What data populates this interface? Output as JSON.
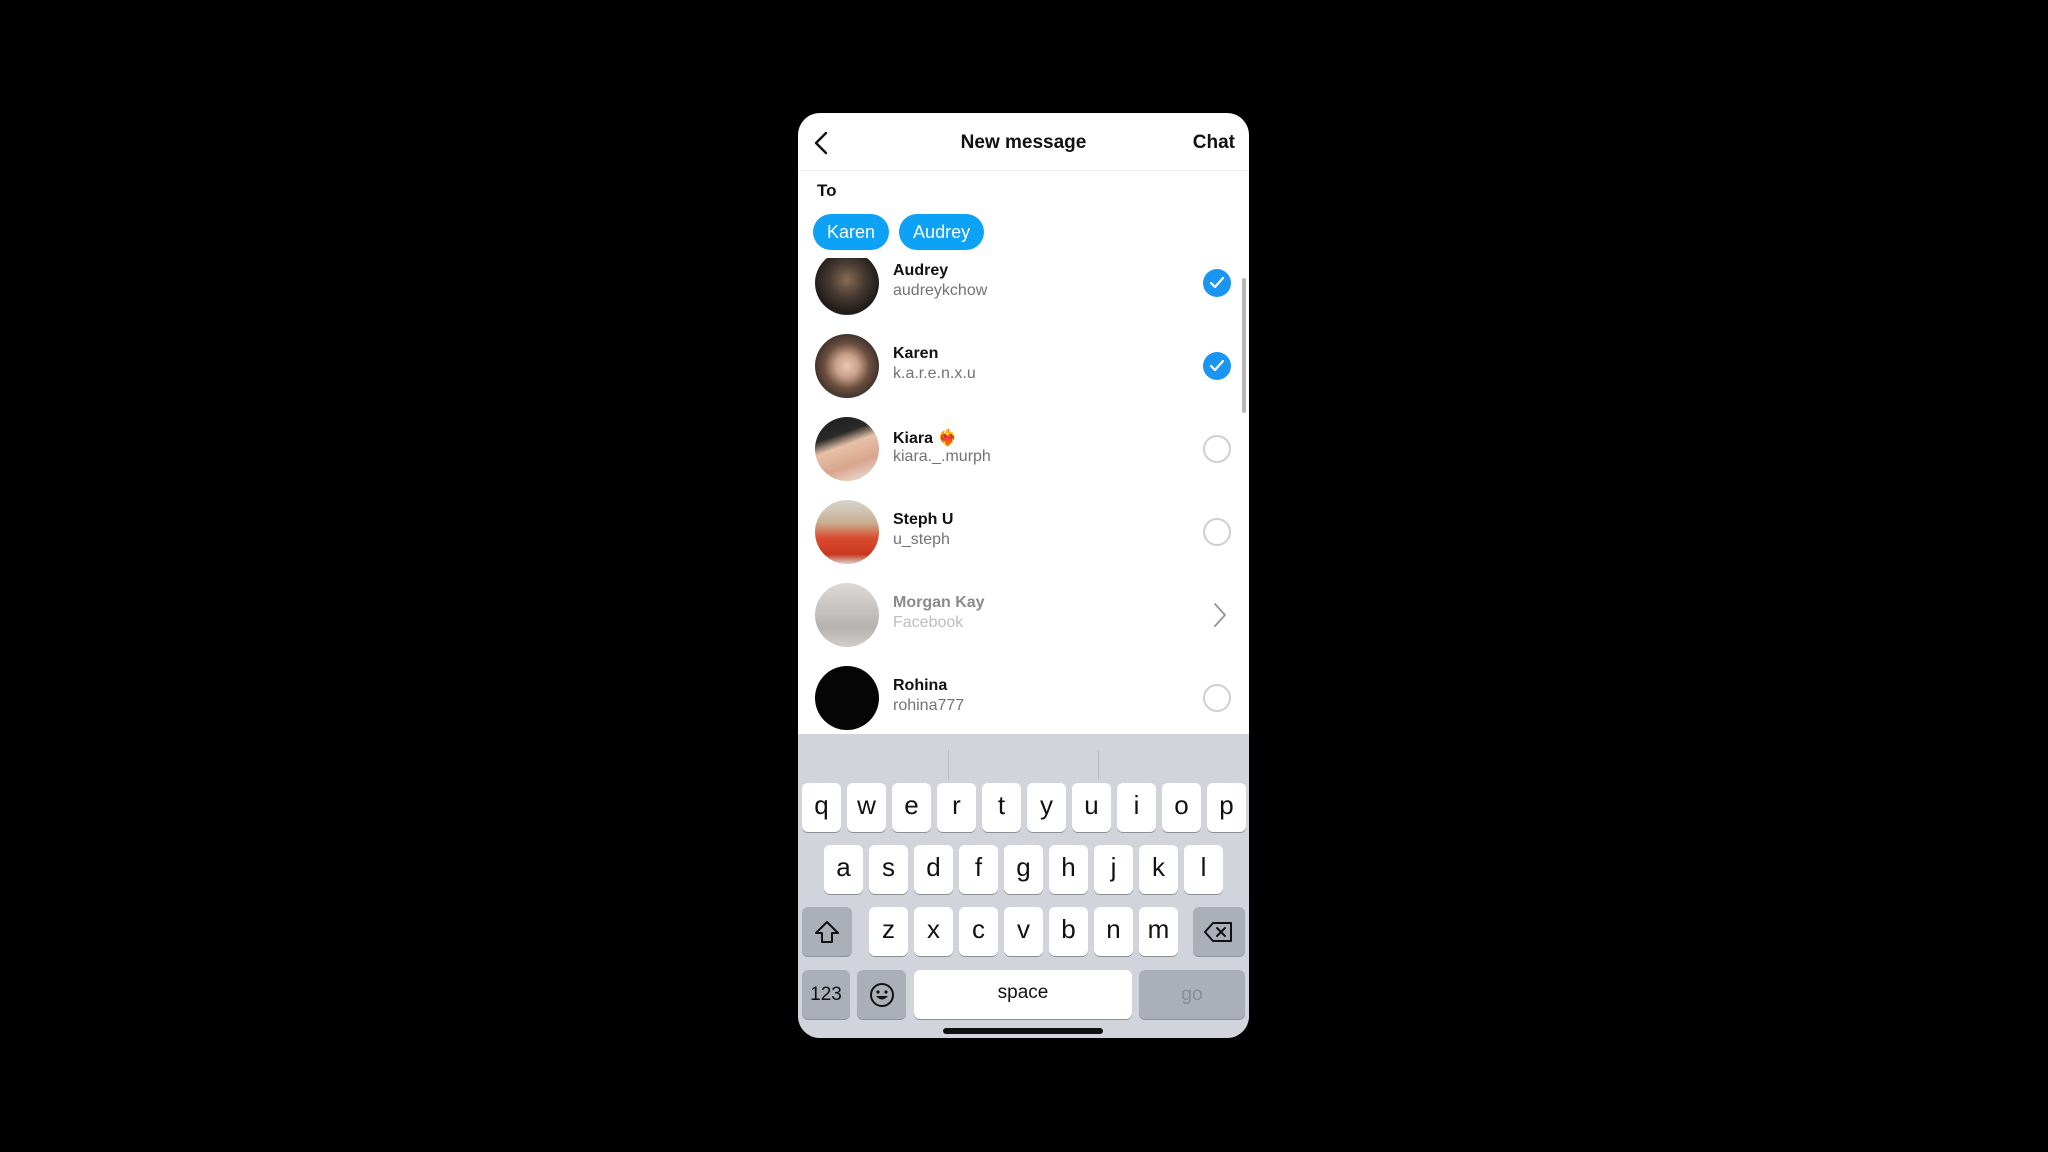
{
  "header": {
    "back_icon": "chevron-left-icon",
    "title": "New message",
    "chat_label": "Chat"
  },
  "recipients": {
    "to_label": "To",
    "chips": [
      "Karen",
      "Audrey"
    ],
    "chip_color": "#0da2f5"
  },
  "contacts": [
    {
      "name": "Audrey",
      "handle": "audreykchow",
      "state": "selected"
    },
    {
      "name": "Karen",
      "handle": "k.a.r.e.n.x.u",
      "state": "selected"
    },
    {
      "name": "Kiara ❤️‍🔥",
      "handle": "kiara._.murph",
      "state": "unselected"
    },
    {
      "name": "Steph U",
      "handle": "u_steph",
      "state": "unselected"
    },
    {
      "name": "Morgan Kay",
      "handle": "Facebook",
      "state": "external"
    },
    {
      "name": "Rohina",
      "handle": "rohina777",
      "state": "unselected"
    }
  ],
  "accent_color": "#1a95f2",
  "keyboard": {
    "row1": [
      "q",
      "w",
      "e",
      "r",
      "t",
      "y",
      "u",
      "i",
      "o",
      "p"
    ],
    "row2": [
      "a",
      "s",
      "d",
      "f",
      "g",
      "h",
      "j",
      "k",
      "l"
    ],
    "row3": [
      "z",
      "x",
      "c",
      "v",
      "b",
      "n",
      "m"
    ],
    "numbers_label": "123",
    "space_label": "space",
    "go_label": "go",
    "shift_icon": "shift-icon",
    "delete_icon": "backspace-icon",
    "emoji_icon": "emoji-icon"
  }
}
